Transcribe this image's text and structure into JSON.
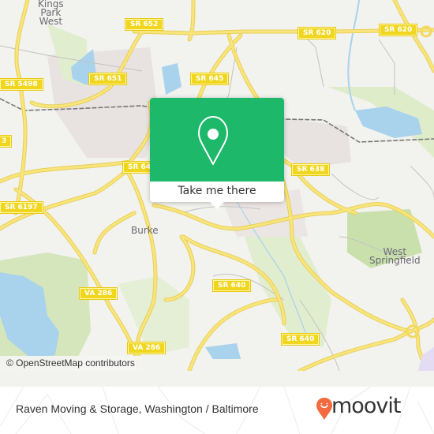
{
  "map": {
    "place_labels": [
      {
        "id": "kings-park-west",
        "lines": [
          "Kings",
          "Park",
          "West"
        ]
      },
      {
        "id": "burke",
        "lines": [
          "Burke"
        ]
      },
      {
        "id": "west-springfield",
        "lines": [
          "West",
          "Springfield"
        ]
      }
    ],
    "road_shields": [
      {
        "id": "sr-652",
        "label": "SR 652"
      },
      {
        "id": "sr-620-a",
        "label": "SR 620"
      },
      {
        "id": "sr-620-b",
        "label": "SR 620"
      },
      {
        "id": "sr-5498",
        "label": "SR 5498"
      },
      {
        "id": "sr-651",
        "label": "SR 651"
      },
      {
        "id": "sr-645",
        "label": "SR 645"
      },
      {
        "id": "sr-643-partial",
        "label": "3"
      },
      {
        "id": "sr-64x-partial",
        "label": "SR 64"
      },
      {
        "id": "sr-638",
        "label": "SR 638"
      },
      {
        "id": "sr-6197",
        "label": "SR 6197"
      },
      {
        "id": "va-286-a",
        "label": "VA 286"
      },
      {
        "id": "sr-640-a",
        "label": "SR 640"
      },
      {
        "id": "sr-640-b",
        "label": "SR 640"
      },
      {
        "id": "va-286-b",
        "label": "VA 286"
      }
    ],
    "colors": {
      "background": "#f2f2ef",
      "road": "#f3dc6a",
      "water": "#a9d3ec",
      "park": "#d8e8c0",
      "urban": "#e6e0dd",
      "rail": "#777777"
    }
  },
  "popup": {
    "icon": "location-pin-icon",
    "button_label": "Take me there",
    "accent_color": "#1db86a"
  },
  "attribution": "© OpenStreetMap contributors",
  "footer": {
    "title": "Raven Moving & Storage, Washington / Baltimore",
    "logo_text": "moovit",
    "logo_color": "#f26a3d"
  }
}
